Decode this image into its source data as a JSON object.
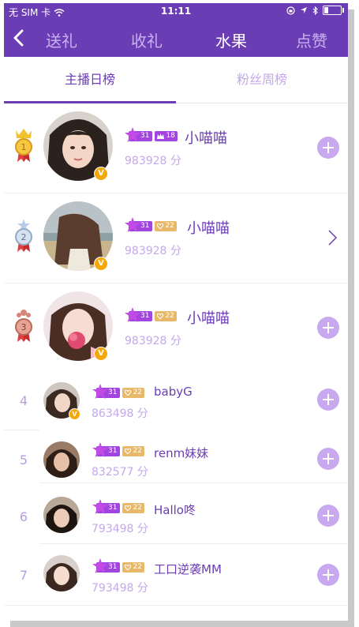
{
  "status_bar": {
    "carrier": "无 SIM 卡",
    "time": "11:11"
  },
  "navbar": {
    "tabs": [
      {
        "label": "送礼",
        "active": false
      },
      {
        "label": "收礼",
        "active": false
      },
      {
        "label": "水果",
        "active": true
      },
      {
        "label": "点赞",
        "active": false
      }
    ]
  },
  "subtabs": [
    {
      "label": "主播日榜",
      "active": true
    },
    {
      "label": "粉丝周榜",
      "active": false
    }
  ],
  "colors": {
    "brand": "#6b3db5",
    "accent_light": "#c3a9ea",
    "level_badge": "#a244e0",
    "heart_badge": "#e8b96a",
    "vip": "#f5a80a"
  },
  "rankings": [
    {
      "rank": "1",
      "level": "31",
      "second_badge": "crown",
      "second_value": "18",
      "name": "小喵喵",
      "score": "983928 分",
      "action": "plus",
      "medal": "gold"
    },
    {
      "rank": "2",
      "level": "31",
      "second_badge": "heart",
      "second_value": "22",
      "name": "小喵喵",
      "score": "983928 分",
      "action": "chevron",
      "medal": "silver"
    },
    {
      "rank": "3",
      "level": "31",
      "second_badge": "heart",
      "second_value": "22",
      "name": "小喵喵",
      "score": "983928 分",
      "action": "plus",
      "medal": "bronze"
    },
    {
      "rank": "4",
      "level": "31",
      "second_badge": "heart",
      "second_value": "22",
      "name": "babyG",
      "score": "863498 分",
      "action": "plus",
      "vip": true
    },
    {
      "rank": "5",
      "level": "31",
      "second_badge": "heart",
      "second_value": "22",
      "name": "renm妹妹",
      "score": "832577 分",
      "action": "plus"
    },
    {
      "rank": "6",
      "level": "31",
      "second_badge": "heart",
      "second_value": "22",
      "name": "Hallo咚",
      "score": "793498 分",
      "action": "plus"
    },
    {
      "rank": "7",
      "level": "31",
      "second_badge": "heart",
      "second_value": "22",
      "name": "工口逆袭MM",
      "score": "793498 分",
      "action": "plus"
    }
  ],
  "vip_label": "V"
}
